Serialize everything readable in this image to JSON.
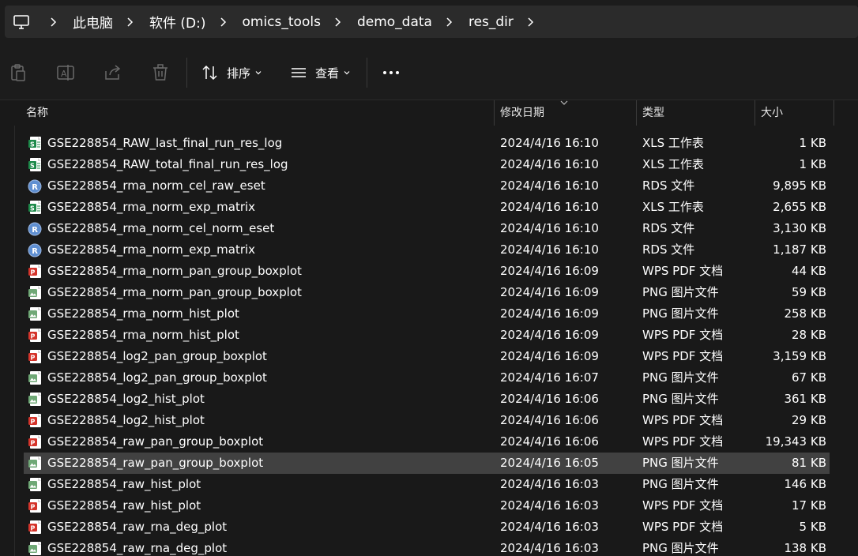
{
  "breadcrumb": {
    "items": [
      "此电脑",
      "软件 (D:)",
      "omics_tools",
      "demo_data",
      "res_dir"
    ]
  },
  "toolbar": {
    "sort_label": "排序",
    "view_label": "查看"
  },
  "columns": {
    "name": "名称",
    "modified": "修改日期",
    "type": "类型",
    "size": "大小"
  },
  "files": [
    {
      "name": "GSE228854_RAW_last_final_run_res_log",
      "date": "2024/4/16 16:10",
      "type": "XLS 工作表",
      "size": "1 KB",
      "icon": "xls-file-icon"
    },
    {
      "name": "GSE228854_RAW_total_final_run_res_log",
      "date": "2024/4/16 16:10",
      "type": "XLS 工作表",
      "size": "1 KB",
      "icon": "xls-file-icon"
    },
    {
      "name": "GSE228854_rma_norm_cel_raw_eset",
      "date": "2024/4/16 16:10",
      "type": "RDS 文件",
      "size": "9,895 KB",
      "icon": "r-file-icon"
    },
    {
      "name": "GSE228854_rma_norm_exp_matrix",
      "date": "2024/4/16 16:10",
      "type": "XLS 工作表",
      "size": "2,655 KB",
      "icon": "xls-file-icon"
    },
    {
      "name": "GSE228854_rma_norm_cel_norm_eset",
      "date": "2024/4/16 16:10",
      "type": "RDS 文件",
      "size": "3,130 KB",
      "icon": "r-file-icon"
    },
    {
      "name": "GSE228854_rma_norm_exp_matrix",
      "date": "2024/4/16 16:10",
      "type": "RDS 文件",
      "size": "1,187 KB",
      "icon": "r-file-icon"
    },
    {
      "name": "GSE228854_rma_norm_pan_group_boxplot",
      "date": "2024/4/16 16:09",
      "type": "WPS PDF 文档",
      "size": "44 KB",
      "icon": "pdf-file-icon"
    },
    {
      "name": "GSE228854_rma_norm_pan_group_boxplot",
      "date": "2024/4/16 16:09",
      "type": "PNG 图片文件",
      "size": "59 KB",
      "icon": "png-file-icon"
    },
    {
      "name": "GSE228854_rma_norm_hist_plot",
      "date": "2024/4/16 16:09",
      "type": "PNG 图片文件",
      "size": "258 KB",
      "icon": "png-file-icon"
    },
    {
      "name": "GSE228854_rma_norm_hist_plot",
      "date": "2024/4/16 16:09",
      "type": "WPS PDF 文档",
      "size": "28 KB",
      "icon": "pdf-file-icon"
    },
    {
      "name": "GSE228854_log2_pan_group_boxplot",
      "date": "2024/4/16 16:09",
      "type": "WPS PDF 文档",
      "size": "3,159 KB",
      "icon": "pdf-file-icon"
    },
    {
      "name": "GSE228854_log2_pan_group_boxplot",
      "date": "2024/4/16 16:07",
      "type": "PNG 图片文件",
      "size": "67 KB",
      "icon": "png-file-icon"
    },
    {
      "name": "GSE228854_log2_hist_plot",
      "date": "2024/4/16 16:06",
      "type": "PNG 图片文件",
      "size": "361 KB",
      "icon": "png-file-icon"
    },
    {
      "name": "GSE228854_log2_hist_plot",
      "date": "2024/4/16 16:06",
      "type": "WPS PDF 文档",
      "size": "29 KB",
      "icon": "pdf-file-icon"
    },
    {
      "name": "GSE228854_raw_pan_group_boxplot",
      "date": "2024/4/16 16:06",
      "type": "WPS PDF 文档",
      "size": "19,343 KB",
      "icon": "pdf-file-icon"
    },
    {
      "name": "GSE228854_raw_pan_group_boxplot",
      "date": "2024/4/16 16:05",
      "type": "PNG 图片文件",
      "size": "81 KB",
      "icon": "png-file-icon",
      "selected": true
    },
    {
      "name": "GSE228854_raw_hist_plot",
      "date": "2024/4/16 16:03",
      "type": "PNG 图片文件",
      "size": "146 KB",
      "icon": "png-file-icon"
    },
    {
      "name": "GSE228854_raw_hist_plot",
      "date": "2024/4/16 16:03",
      "type": "WPS PDF 文档",
      "size": "17 KB",
      "icon": "pdf-file-icon"
    },
    {
      "name": "GSE228854_raw_rna_deg_plot",
      "date": "2024/4/16 16:03",
      "type": "WPS PDF 文档",
      "size": "5 KB",
      "icon": "pdf-file-icon"
    },
    {
      "name": "GSE228854_raw_rna_deg_plot",
      "date": "2024/4/16 16:03",
      "type": "PNG 图片文件",
      "size": "138 KB",
      "icon": "png-file-icon"
    }
  ],
  "colors": {
    "background": "#191919",
    "address_bar": "#2b2b2b",
    "selected_row": "#414141",
    "xls_green": "#1d8a4a",
    "pdf_red": "#d5342b",
    "r_blue": "#5f8fd1",
    "png_green": "#6fa876"
  }
}
